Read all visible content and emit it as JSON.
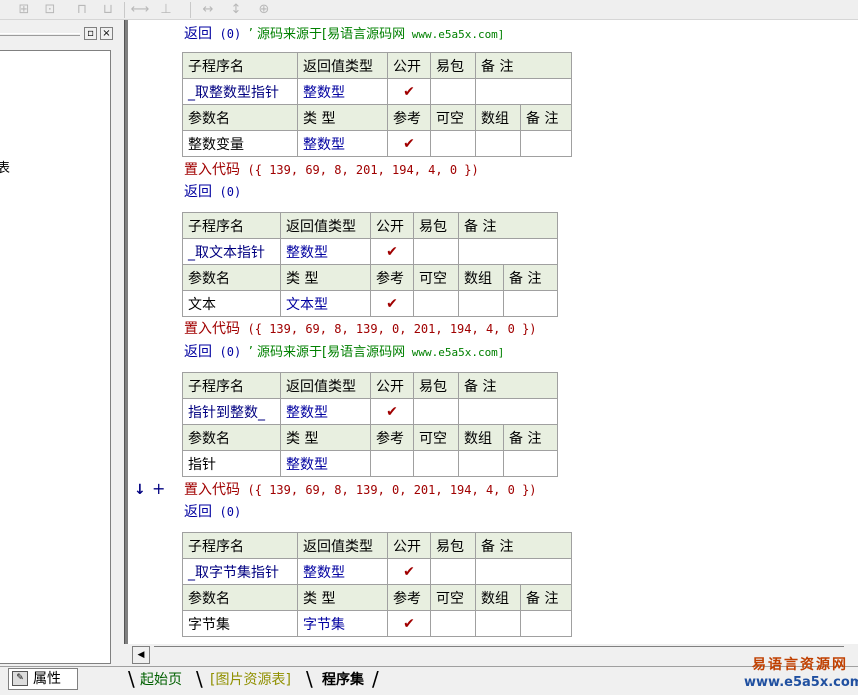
{
  "toolbar": {
    "icons": [
      "align-left-icon",
      "align-center-icon",
      "align-top-icon",
      "align-bottom-icon",
      "space-horizontal-icon",
      "space-vertical-icon",
      "resize-width-icon",
      "resize-height-icon",
      "resize-both-icon"
    ]
  },
  "left_panel": {
    "stub_text": "表",
    "property_tab_label": "属性"
  },
  "editor": {
    "blocks": [
      {
        "pre_lines": [
          {
            "kw": "返回",
            "args": "(0)",
            "comment_cn": "’ 源码来源于[易语言源码网",
            "comment_url": " www.e5a5x.com]"
          }
        ],
        "header": [
          "子程序名",
          "返回值类型",
          "公开",
          "易包",
          "备 注"
        ],
        "sub": {
          "name": "_取整数型指针",
          "return_type": "整数型",
          "public": "✔"
        },
        "param_header": [
          "参数名",
          "类 型",
          "参考",
          "可空",
          "数组",
          "备 注"
        ],
        "params": [
          {
            "name": "整数变量",
            "type": "整数型",
            "ref": "✔"
          }
        ],
        "code": [
          {
            "kw": "置入代码",
            "args": "({ 139, 69, 8, 201, 194, 4, 0 })"
          },
          {
            "kw": "返回",
            "args": "(0)"
          }
        ]
      },
      {
        "header": [
          "子程序名",
          "返回值类型",
          "公开",
          "易包",
          "备 注"
        ],
        "sub": {
          "name": "_取文本指针",
          "return_type": "整数型",
          "public": "✔"
        },
        "param_header": [
          "参数名",
          "类 型",
          "参考",
          "可空",
          "数组",
          "备 注"
        ],
        "params": [
          {
            "name": "文本",
            "type": "文本型",
            "ref": "✔"
          }
        ],
        "code": [
          {
            "kw": "置入代码",
            "args": "({ 139, 69, 8, 139, 0, 201, 194, 4, 0 })"
          },
          {
            "kw": "返回",
            "args": "(0)",
            "comment_cn": "’ 源码来源于[易语言源码网",
            "comment_url": " www.e5a5x.com]"
          }
        ]
      },
      {
        "header": [
          "子程序名",
          "返回值类型",
          "公开",
          "易包",
          "备 注"
        ],
        "sub": {
          "name": "指针到整数_",
          "return_type": "整数型",
          "public": "✔"
        },
        "param_header": [
          "参数名",
          "类 型",
          "参考",
          "可空",
          "数组",
          "备 注"
        ],
        "params": [
          {
            "name": "指针",
            "type": "整数型",
            "ref": ""
          }
        ],
        "code": [
          {
            "kw": "置入代码",
            "args": "({ 139, 69, 8, 139, 0, 201, 194, 4, 0 })"
          },
          {
            "kw": "返回",
            "args": "(0)"
          }
        ]
      },
      {
        "header": [
          "子程序名",
          "返回值类型",
          "公开",
          "易包",
          "备 注"
        ],
        "sub": {
          "name": "_取字节集指针",
          "return_type": "整数型",
          "public": "✔"
        },
        "param_header": [
          "参数名",
          "类 型",
          "参考",
          "可空",
          "数组",
          "备 注"
        ],
        "params": [
          {
            "name": "字节集",
            "type": "字节集",
            "ref": "✔"
          }
        ]
      }
    ],
    "markers": {
      "arrow": "↓",
      "plus": "+"
    }
  },
  "bottom_tabs": [
    "起始页",
    "[图片资源表]",
    "程序集"
  ],
  "watermark": {
    "cn": "易语言资源网",
    "url": "www.e5a5x.com"
  },
  "colors": {
    "keyword_blue": "#0000a0",
    "keyword_red": "#a00000",
    "comment_green": "#008000",
    "table_header": "#e8efe0"
  }
}
